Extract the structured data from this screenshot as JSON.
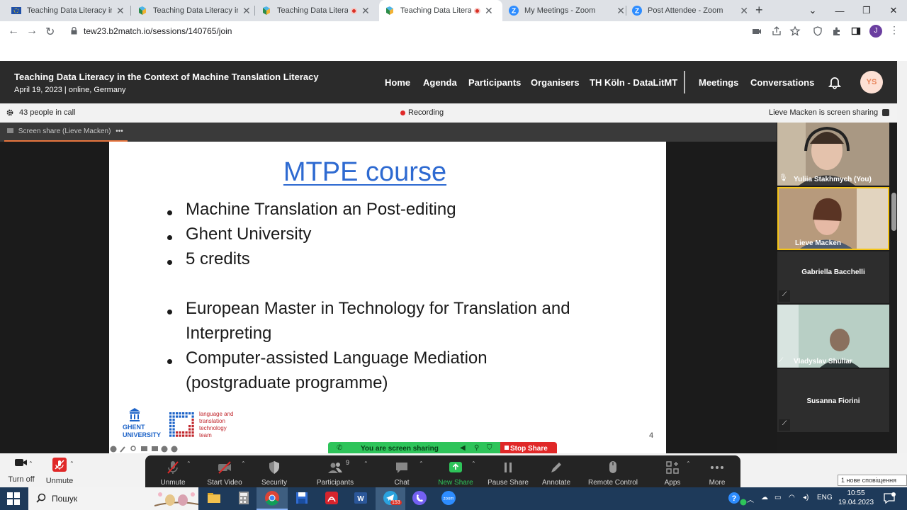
{
  "browser": {
    "tabs": [
      {
        "title": "Teaching Data Literacy in th",
        "favicon": "eu-flag-icon",
        "recording": false,
        "active": false
      },
      {
        "title": "Teaching Data Literacy in th",
        "favicon": "b2match-icon",
        "recording": false,
        "active": false
      },
      {
        "title": "Teaching Data Literacy",
        "favicon": "b2match-icon",
        "recording": true,
        "active": false
      },
      {
        "title": "Teaching Data Literacy",
        "favicon": "b2match-icon",
        "recording": true,
        "active": true
      },
      {
        "title": "My Meetings - Zoom",
        "favicon": "zoom-icon",
        "recording": false,
        "active": false
      },
      {
        "title": "Post Attendee - Zoom",
        "favicon": "zoom-icon",
        "recording": false,
        "active": false
      }
    ],
    "url": "tew23.b2match.io/sessions/140765/join",
    "profile_initial": "J"
  },
  "site": {
    "event_title": "Teaching Data Literacy in the Context of Machine Translation Literacy",
    "event_date": "April 19, 2023 | online, Germany",
    "nav": [
      "Home",
      "Agenda",
      "Participants",
      "Organisers",
      "TH Köln - DataLitMT",
      "Meetings",
      "Conversations"
    ],
    "avatar_initials": "YS"
  },
  "call": {
    "people_count": "43 people in call",
    "recording": "Recording",
    "sharing_status": "Lieve Macken is screen sharing",
    "share_tab": "Screen share (Lieve Macken)",
    "share_tab_menu": "•••"
  },
  "slide": {
    "title": "MTPE course",
    "bullets": [
      "Machine Translation an Post-editing",
      "Ghent University",
      "5 credits",
      "European Master in Technology for Translation and",
      "Interpreting",
      "Computer-assisted Language Mediation",
      "(postgraduate programme)"
    ],
    "logo_ghent": [
      "GHENT",
      "UNIVERSITY"
    ],
    "logo_lt3": [
      "language and",
      "translation",
      "technology",
      "team"
    ],
    "page_number": "4"
  },
  "sharing_bar": {
    "status": "You are screen sharing",
    "stop": "Stop Share"
  },
  "participants": [
    {
      "name": "Yuliia Stakhmych (You)",
      "video": true
    },
    {
      "name": "Lieve Macken",
      "video": true,
      "active_speaker": true
    },
    {
      "name": "Gabriella Bacchelli",
      "video": false
    },
    {
      "name": "Vladyslav Shuliar",
      "video": true
    },
    {
      "name": "Susanna Fiorini",
      "video": false
    }
  ],
  "zoom_toolbar": {
    "left": [
      {
        "label": "Turn off",
        "icon": "camera-icon"
      },
      {
        "label": "Unmute",
        "icon": "mic-muted-icon"
      }
    ],
    "items": [
      {
        "label": "Unmute",
        "icon": "mic-muted-icon"
      },
      {
        "label": "Start Video",
        "icon": "video-off-icon"
      },
      {
        "label": "Security",
        "icon": "shield-icon"
      },
      {
        "label": "Participants",
        "icon": "participants-icon",
        "count": "9"
      },
      {
        "label": "Chat",
        "icon": "chat-icon"
      },
      {
        "label": "New Share",
        "icon": "share-icon"
      },
      {
        "label": "Pause Share",
        "icon": "pause-icon"
      },
      {
        "label": "Annotate",
        "icon": "pencil-icon"
      },
      {
        "label": "Remote Control",
        "icon": "mouse-icon"
      },
      {
        "label": "Apps",
        "icon": "apps-icon"
      },
      {
        "label": "More",
        "icon": "more-icon"
      }
    ],
    "accent": "#2ec45a"
  },
  "taskbar": {
    "search_text": "Пошук",
    "telegram_badge": "153",
    "lang": "ENG",
    "time": "10:55",
    "date": "19.04.2023",
    "notification": "1 нове сповіщення"
  }
}
